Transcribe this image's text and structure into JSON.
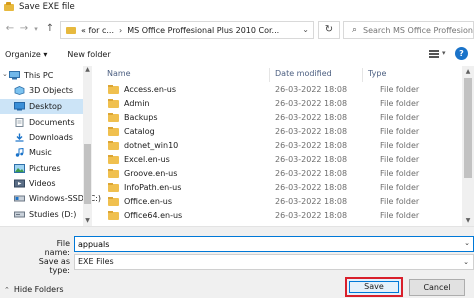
{
  "window": {
    "title": "Save EXE file"
  },
  "address": {
    "crumbs": [
      "« for c...",
      "MS Office Proffesional Plus 2010 Cor..."
    ],
    "search_placeholder": "Search MS Office Proffesion..."
  },
  "toolbar": {
    "organize": "Organize ▾",
    "new_folder": "New folder"
  },
  "nav": {
    "items": [
      {
        "label": "This PC",
        "icon": "computer-icon"
      },
      {
        "label": "3D Objects",
        "icon": "cube-icon"
      },
      {
        "label": "Desktop",
        "icon": "desktop-icon",
        "selected": true
      },
      {
        "label": "Documents",
        "icon": "documents-icon"
      },
      {
        "label": "Downloads",
        "icon": "download-icon"
      },
      {
        "label": "Music",
        "icon": "music-icon"
      },
      {
        "label": "Pictures",
        "icon": "pictures-icon"
      },
      {
        "label": "Videos",
        "icon": "videos-icon"
      },
      {
        "label": "Windows-SSD (C:)",
        "icon": "drive-icon"
      },
      {
        "label": "Studies (D:)",
        "icon": "drive-icon"
      }
    ]
  },
  "list": {
    "columns": {
      "name": "Name",
      "date": "Date modified",
      "type": "Type"
    },
    "rows": [
      {
        "name": "Access.en-us",
        "date": "26-03-2022 18:08",
        "type": "File folder"
      },
      {
        "name": "Admin",
        "date": "26-03-2022 18:08",
        "type": "File folder"
      },
      {
        "name": "Backups",
        "date": "26-03-2022 18:08",
        "type": "File folder"
      },
      {
        "name": "Catalog",
        "date": "26-03-2022 18:08",
        "type": "File folder"
      },
      {
        "name": "dotnet_win10",
        "date": "26-03-2022 18:08",
        "type": "File folder"
      },
      {
        "name": "Excel.en-us",
        "date": "26-03-2022 18:08",
        "type": "File folder"
      },
      {
        "name": "Groove.en-us",
        "date": "26-03-2022 18:08",
        "type": "File folder"
      },
      {
        "name": "InfoPath.en-us",
        "date": "26-03-2022 18:08",
        "type": "File folder"
      },
      {
        "name": "Office.en-us",
        "date": "26-03-2022 18:08",
        "type": "File folder"
      },
      {
        "name": "Office64.en-us",
        "date": "26-03-2022 18:08",
        "type": "File folder"
      }
    ]
  },
  "form": {
    "filename_label": "File name:",
    "filename_value": "appuals",
    "type_label": "Save as type:",
    "type_value": "EXE Files"
  },
  "footer": {
    "hide_folders": "Hide Folders",
    "save": "Save",
    "cancel": "Cancel"
  },
  "colors": {
    "selected": "#cce4f7",
    "accent": "#0078d7",
    "highlight": "#d9202b"
  }
}
